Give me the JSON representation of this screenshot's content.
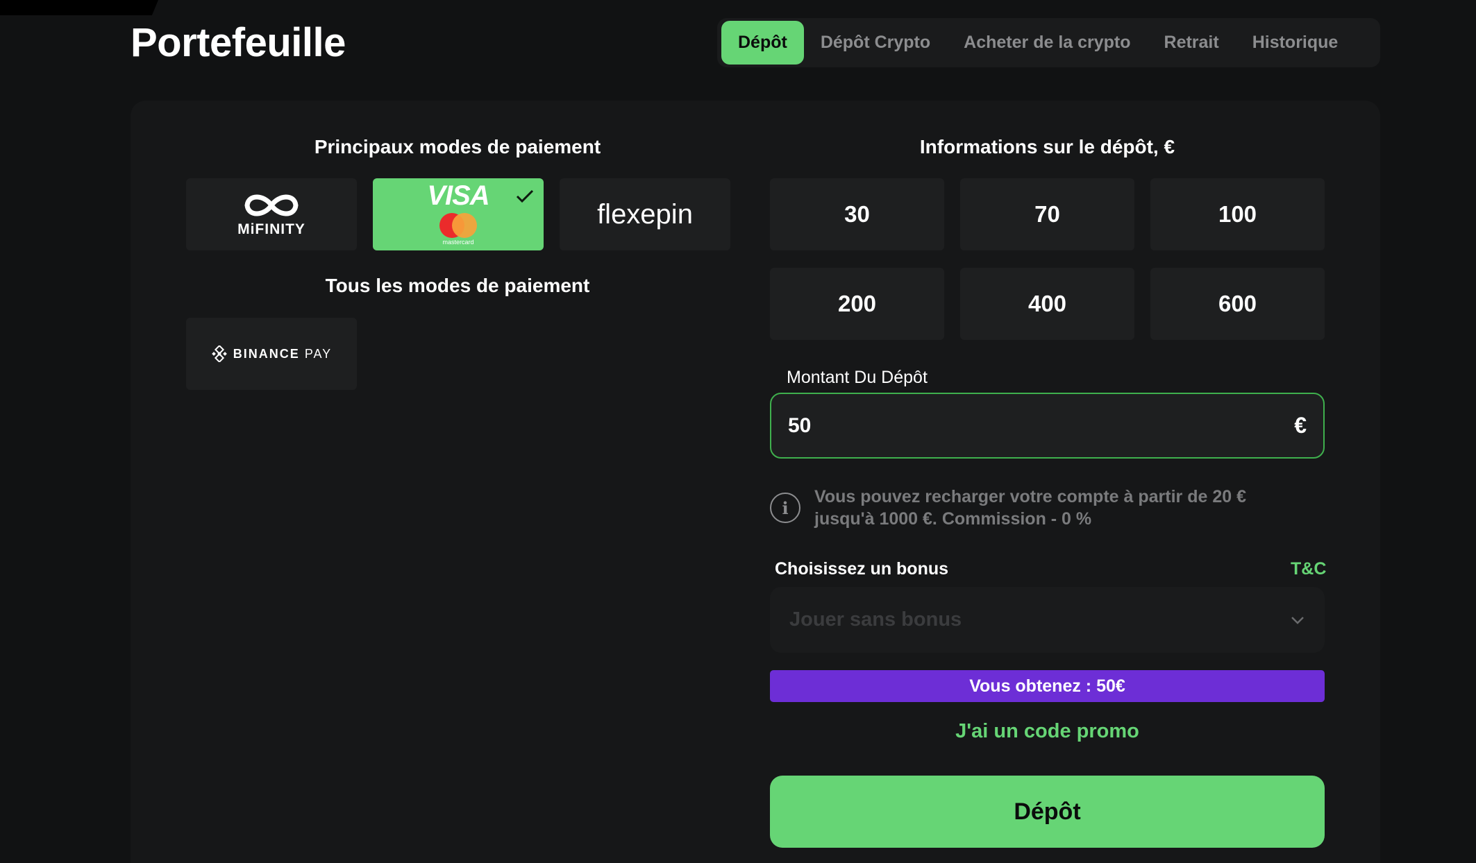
{
  "page": {
    "title": "Portefeuille"
  },
  "tabs": [
    {
      "label": "Dépôt",
      "active": true
    },
    {
      "label": "Dépôt Crypto",
      "active": false
    },
    {
      "label": "Acheter de la crypto",
      "active": false
    },
    {
      "label": "Retrait",
      "active": false
    },
    {
      "label": "Historique",
      "active": false
    }
  ],
  "payment": {
    "main_heading": "Principaux modes de paiement",
    "all_heading": "Tous les modes de paiement",
    "methods": {
      "mifinity": {
        "name": "MiFINITY",
        "icon": "infinity-icon"
      },
      "visa": {
        "visa_text": "VISA",
        "mastercard_text": "mastercard",
        "selected": true,
        "icon": "check-icon"
      },
      "flexepin": {
        "name": "flexepin"
      },
      "binance": {
        "name": "BINANCE",
        "suffix": "PAY",
        "icon": "binance-icon"
      }
    }
  },
  "deposit": {
    "heading": "Informations sur le dépôt, €",
    "amounts": [
      "30",
      "70",
      "100",
      "200",
      "400",
      "600"
    ],
    "amount_label": "Montant Du Dépôt",
    "amount_value": "50",
    "currency_symbol": "€",
    "info_icon": "info-icon",
    "info_text": "Vous pouvez recharger votre compte à partir de 20 € jusqu'à 1000 €. Commission - 0 %",
    "bonus_label": "Choisissez un bonus",
    "tc_label": "T&C",
    "bonus_selected": "Jouer sans bonus",
    "gain_text": "Vous obtenez : 50€",
    "promo_text": "J'ai un code promo",
    "submit_label": "Dépôt"
  },
  "colors": {
    "accent": "#66d575",
    "purple": "#6d2ed6",
    "background": "#111213",
    "card": "#161718",
    "tile": "#1e1f20"
  }
}
